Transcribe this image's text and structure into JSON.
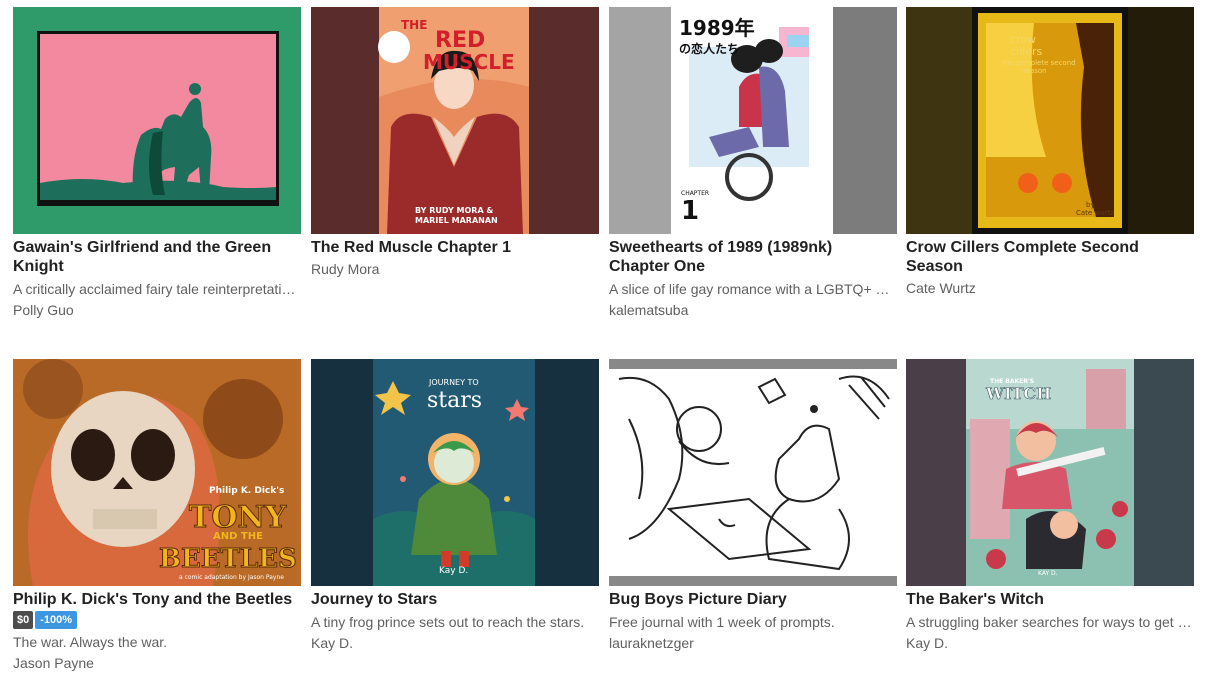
{
  "games": [
    {
      "title": "Gawain's Girlfriend and the Green Knight",
      "description": "A critically acclaimed fairy tale reinterpretation...",
      "author": "Polly Guo",
      "cover_colors": {
        "bg": "#2f9a6a",
        "panel": "#f2899f",
        "figure": "#1d6e5a"
      }
    },
    {
      "title": "The Red Muscle Chapter 1",
      "description": "",
      "author": "Rudy Mora",
      "cover_text": [
        "THE",
        "RED",
        "MUSCLE",
        "BY RUDY MORA &",
        "MARIEL MARANAN"
      ],
      "cover_colors": {
        "bg": "#7a3a3a",
        "panel": "#e37a52",
        "figure": "#9b2b2b"
      }
    },
    {
      "title": "Sweethearts of 1989 (1989nk) Chapter One",
      "description": "A slice of life gay romance with a LGBTQ+ narr...",
      "author": "kalematsuba",
      "cover_text": [
        "1989年",
        "の恋人たち",
        "CHAPTER",
        "1"
      ],
      "cover_colors": {
        "bg": "#9a9a9a",
        "panel": "#ffffff",
        "figure": "#c9344a"
      }
    },
    {
      "title": "Crow Cillers Complete Second Season",
      "description": "",
      "author": "Cate Wurtz",
      "cover_text": [
        "crow",
        "cillers",
        "the complete second",
        "season",
        "by",
        "Cate wurtz"
      ],
      "cover_colors": {
        "bg": "#3a2e10",
        "panel": "#d8a810",
        "figure": "#f2c200"
      }
    },
    {
      "title": "Philip K. Dick's Tony and the Beetles",
      "price": "$0",
      "discount": "-100%",
      "description": "The war. Always the war.",
      "author": "Jason Payne",
      "cover_text": [
        "Philip K. Dick's",
        "TONY",
        "AND THE",
        "BEETLES",
        "a comic adaptation by Jason Payne"
      ],
      "cover_colors": {
        "bg": "#c9772e",
        "panel": "#e8d6c2",
        "figure": "#f2b51d"
      }
    },
    {
      "title": "Journey to Stars",
      "description": "A tiny frog prince sets out to reach the stars.",
      "author": "Kay D.",
      "cover_text": [
        "JOURNEY TO",
        "stars",
        "Kay D."
      ],
      "cover_colors": {
        "bg": "#1e4960",
        "panel": "#235a73",
        "figure": "#4f8a3a"
      }
    },
    {
      "title": "Bug Boys Picture Diary",
      "description": "Free journal with 1 week of prompts.",
      "author": "lauraknetzger",
      "cover_colors": {
        "bg": "#ffffff",
        "panel": "#ffffff",
        "figure": "#222222"
      }
    },
    {
      "title": "The Baker's Witch",
      "description": "A struggling baker searches for ways to get rid ...",
      "author": "Kay D.",
      "cover_text": [
        "THE BAKER'S",
        "WITCH",
        "KAY D."
      ],
      "cover_colors": {
        "bg": "#3c4a52",
        "panel": "#8cc0b0",
        "figure": "#d8566a"
      }
    }
  ]
}
